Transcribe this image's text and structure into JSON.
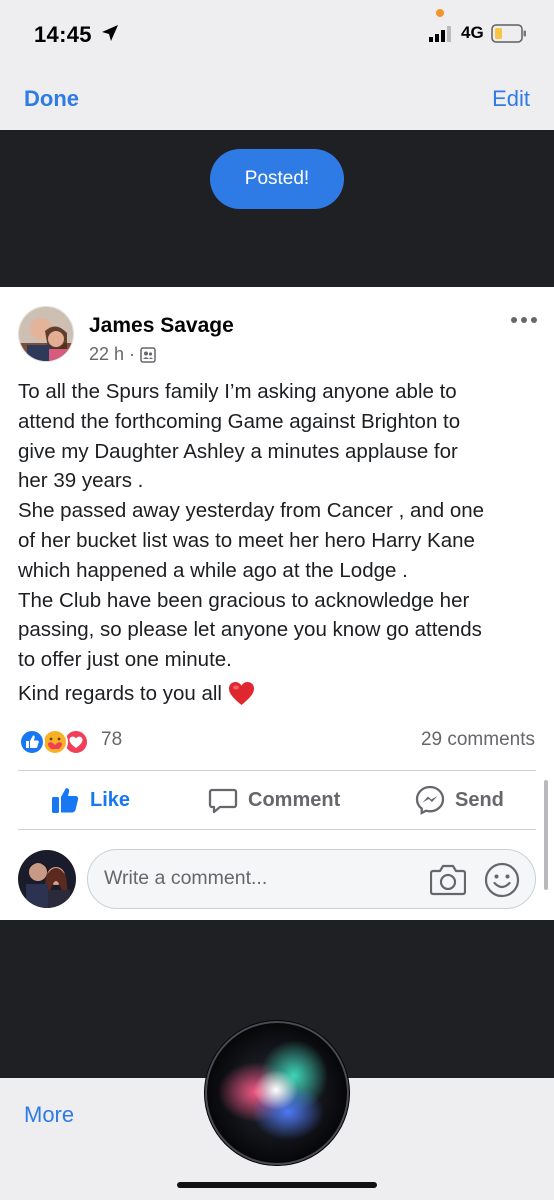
{
  "status_bar": {
    "time": "14:45",
    "network": "4G",
    "icons": [
      "location-arrow-icon",
      "signal-bars-icon",
      "battery-low-icon"
    ],
    "colors": {
      "privacy_dot": "#f0952e",
      "battery_fill": "#f5c543"
    }
  },
  "nav": {
    "done_label": "Done",
    "edit_label": "Edit",
    "accent": "#2f7be5"
  },
  "banner": {
    "posted_label": "Posted!",
    "color": "#2f7be5"
  },
  "post": {
    "author": "James Savage",
    "time": "22 h ·",
    "audience_icon": "friends-icon",
    "lines": [
      "To all the Spurs family I’m asking anyone able to",
      "attend the forthcoming Game against Brighton to",
      "give my Daughter Ashley a minutes applause for",
      "her 39 years .",
      "She passed away yesterday from Cancer , and one",
      "of her bucket list was to meet her hero Harry Kane",
      "which happened a while ago at the Lodge .",
      "The Club have been gracious to acknowledge her",
      "passing, so please let anyone you know go attends",
      "to offer just one minute."
    ],
    "closing": "Kind regards to you all",
    "reactions": [
      "like-icon",
      "care-icon",
      "love-icon"
    ],
    "reaction_count": "78",
    "comment_count": "29 comments"
  },
  "actions": {
    "like": "Like",
    "comment": "Comment",
    "send": "Send",
    "like_color": "#1877f2"
  },
  "composer": {
    "placeholder": "Write a comment..."
  },
  "bottom": {
    "more_label": "More"
  }
}
